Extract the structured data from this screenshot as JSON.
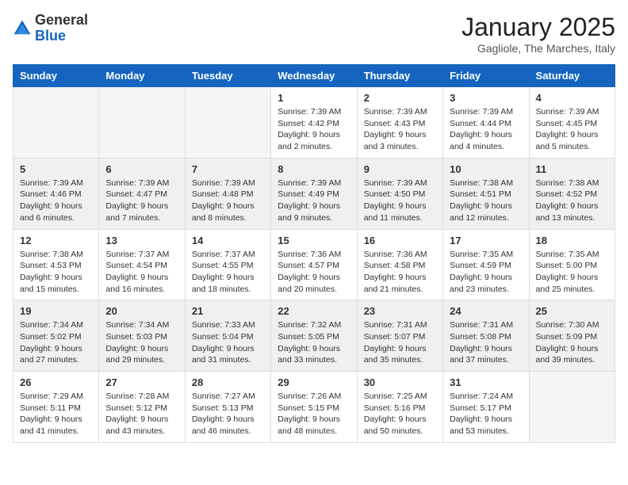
{
  "header": {
    "logo_general": "General",
    "logo_blue": "Blue",
    "month_title": "January 2025",
    "subtitle": "Gagliole, The Marches, Italy"
  },
  "weekdays": [
    "Sunday",
    "Monday",
    "Tuesday",
    "Wednesday",
    "Thursday",
    "Friday",
    "Saturday"
  ],
  "weeks": [
    [
      {
        "day": "",
        "info": ""
      },
      {
        "day": "",
        "info": ""
      },
      {
        "day": "",
        "info": ""
      },
      {
        "day": "1",
        "info": "Sunrise: 7:39 AM\nSunset: 4:42 PM\nDaylight: 9 hours\nand 2 minutes."
      },
      {
        "day": "2",
        "info": "Sunrise: 7:39 AM\nSunset: 4:43 PM\nDaylight: 9 hours\nand 3 minutes."
      },
      {
        "day": "3",
        "info": "Sunrise: 7:39 AM\nSunset: 4:44 PM\nDaylight: 9 hours\nand 4 minutes."
      },
      {
        "day": "4",
        "info": "Sunrise: 7:39 AM\nSunset: 4:45 PM\nDaylight: 9 hours\nand 5 minutes."
      }
    ],
    [
      {
        "day": "5",
        "info": "Sunrise: 7:39 AM\nSunset: 4:46 PM\nDaylight: 9 hours\nand 6 minutes."
      },
      {
        "day": "6",
        "info": "Sunrise: 7:39 AM\nSunset: 4:47 PM\nDaylight: 9 hours\nand 7 minutes."
      },
      {
        "day": "7",
        "info": "Sunrise: 7:39 AM\nSunset: 4:48 PM\nDaylight: 9 hours\nand 8 minutes."
      },
      {
        "day": "8",
        "info": "Sunrise: 7:39 AM\nSunset: 4:49 PM\nDaylight: 9 hours\nand 9 minutes."
      },
      {
        "day": "9",
        "info": "Sunrise: 7:39 AM\nSunset: 4:50 PM\nDaylight: 9 hours\nand 11 minutes."
      },
      {
        "day": "10",
        "info": "Sunrise: 7:38 AM\nSunset: 4:51 PM\nDaylight: 9 hours\nand 12 minutes."
      },
      {
        "day": "11",
        "info": "Sunrise: 7:38 AM\nSunset: 4:52 PM\nDaylight: 9 hours\nand 13 minutes."
      }
    ],
    [
      {
        "day": "12",
        "info": "Sunrise: 7:38 AM\nSunset: 4:53 PM\nDaylight: 9 hours\nand 15 minutes."
      },
      {
        "day": "13",
        "info": "Sunrise: 7:37 AM\nSunset: 4:54 PM\nDaylight: 9 hours\nand 16 minutes."
      },
      {
        "day": "14",
        "info": "Sunrise: 7:37 AM\nSunset: 4:55 PM\nDaylight: 9 hours\nand 18 minutes."
      },
      {
        "day": "15",
        "info": "Sunrise: 7:36 AM\nSunset: 4:57 PM\nDaylight: 9 hours\nand 20 minutes."
      },
      {
        "day": "16",
        "info": "Sunrise: 7:36 AM\nSunset: 4:58 PM\nDaylight: 9 hours\nand 21 minutes."
      },
      {
        "day": "17",
        "info": "Sunrise: 7:35 AM\nSunset: 4:59 PM\nDaylight: 9 hours\nand 23 minutes."
      },
      {
        "day": "18",
        "info": "Sunrise: 7:35 AM\nSunset: 5:00 PM\nDaylight: 9 hours\nand 25 minutes."
      }
    ],
    [
      {
        "day": "19",
        "info": "Sunrise: 7:34 AM\nSunset: 5:02 PM\nDaylight: 9 hours\nand 27 minutes."
      },
      {
        "day": "20",
        "info": "Sunrise: 7:34 AM\nSunset: 5:03 PM\nDaylight: 9 hours\nand 29 minutes."
      },
      {
        "day": "21",
        "info": "Sunrise: 7:33 AM\nSunset: 5:04 PM\nDaylight: 9 hours\nand 31 minutes."
      },
      {
        "day": "22",
        "info": "Sunrise: 7:32 AM\nSunset: 5:05 PM\nDaylight: 9 hours\nand 33 minutes."
      },
      {
        "day": "23",
        "info": "Sunrise: 7:31 AM\nSunset: 5:07 PM\nDaylight: 9 hours\nand 35 minutes."
      },
      {
        "day": "24",
        "info": "Sunrise: 7:31 AM\nSunset: 5:08 PM\nDaylight: 9 hours\nand 37 minutes."
      },
      {
        "day": "25",
        "info": "Sunrise: 7:30 AM\nSunset: 5:09 PM\nDaylight: 9 hours\nand 39 minutes."
      }
    ],
    [
      {
        "day": "26",
        "info": "Sunrise: 7:29 AM\nSunset: 5:11 PM\nDaylight: 9 hours\nand 41 minutes."
      },
      {
        "day": "27",
        "info": "Sunrise: 7:28 AM\nSunset: 5:12 PM\nDaylight: 9 hours\nand 43 minutes."
      },
      {
        "day": "28",
        "info": "Sunrise: 7:27 AM\nSunset: 5:13 PM\nDaylight: 9 hours\nand 46 minutes."
      },
      {
        "day": "29",
        "info": "Sunrise: 7:26 AM\nSunset: 5:15 PM\nDaylight: 9 hours\nand 48 minutes."
      },
      {
        "day": "30",
        "info": "Sunrise: 7:25 AM\nSunset: 5:16 PM\nDaylight: 9 hours\nand 50 minutes."
      },
      {
        "day": "31",
        "info": "Sunrise: 7:24 AM\nSunset: 5:17 PM\nDaylight: 9 hours\nand 53 minutes."
      },
      {
        "day": "",
        "info": ""
      }
    ]
  ]
}
